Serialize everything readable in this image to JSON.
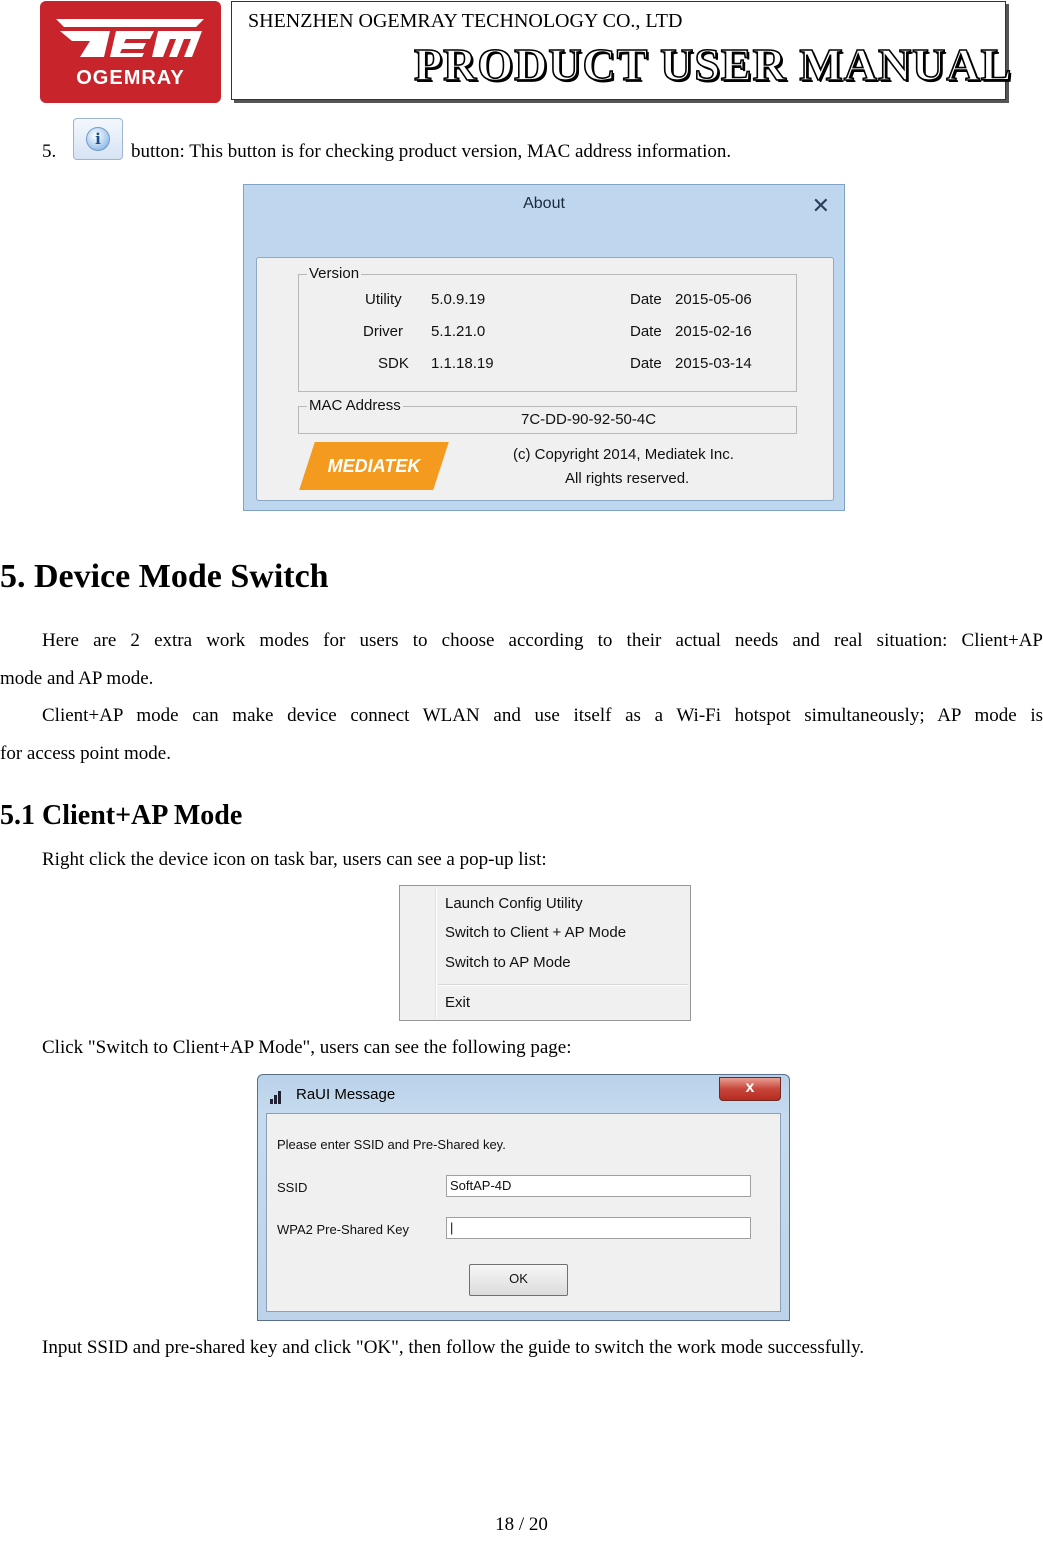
{
  "header": {
    "logo_text": "OGEMRAY",
    "company": "SHENZHEN OGEMRAY TECHNOLOGY CO., LTD",
    "title": "PRODUCT USER MANUAL"
  },
  "item5": {
    "number": "5.",
    "text": "button: This button is for checking product version, MAC address information."
  },
  "about_dialog": {
    "title": "About",
    "close": "✕",
    "version_legend": "Version",
    "rows": [
      {
        "name": "Utility",
        "value": "5.0.9.19",
        "date_label": "Date",
        "date": "2015-05-06"
      },
      {
        "name": "Driver",
        "value": "5.1.21.0",
        "date_label": "Date",
        "date": "2015-02-16"
      },
      {
        "name": "SDK",
        "value": "1.1.18.19",
        "date_label": "Date",
        "date": "2015-03-14"
      }
    ],
    "mac_legend": "MAC Address",
    "mac": "7C-DD-90-92-50-4C",
    "brand": "MEDIATEK",
    "copyright1": "(c) Copyright 2014, Mediatek Inc.",
    "copyright2": "All rights reserved."
  },
  "section5": {
    "heading": "5. Device Mode Switch",
    "para1a": "Here are 2 extra work modes for users to choose according to their actual needs and real situation: Client+AP",
    "para1b": "mode and AP mode.",
    "para2a": "Client+AP mode can make device connect WLAN and use itself as a Wi-Fi hotspot simultaneously; AP mode is",
    "para2b": "for access point mode."
  },
  "section51": {
    "heading": "5.1 Client+AP Mode",
    "para1": "Right click the device icon on task bar, users can see a pop-up list:",
    "para2": "Click \"Switch to Client+AP Mode\", users can see the following page:",
    "para3": "Input SSID and pre-shared key and click \"OK\", then follow the guide to switch the work mode successfully."
  },
  "context_menu": {
    "items": [
      "Launch Config Utility",
      "Switch to Client + AP Mode",
      "Switch to AP Mode",
      "Exit"
    ]
  },
  "raui_dialog": {
    "title": "RaUI Message",
    "close": "x",
    "prompt": "Please enter SSID and Pre-Shared key.",
    "ssid_label": "SSID",
    "ssid_value": "SoftAP-4D",
    "key_label": "WPA2 Pre-Shared Key",
    "key_value": "|",
    "ok": "OK"
  },
  "footer": {
    "page": "18 / 20"
  }
}
